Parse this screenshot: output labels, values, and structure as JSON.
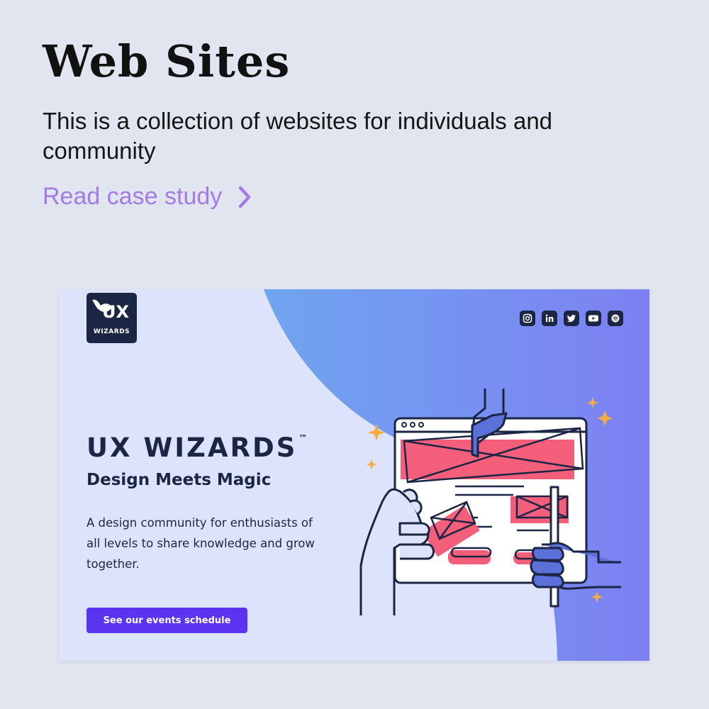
{
  "page": {
    "title": "Web Sites",
    "description": "This is a collection of websites for individuals and community",
    "link_label": "Read case study",
    "link_color": "#a47ae3"
  },
  "card": {
    "logo": {
      "main": "UX",
      "sub": "WIZARDS"
    },
    "social_icons": [
      "instagram-icon",
      "linkedin-icon",
      "twitter-icon",
      "youtube-icon",
      "spotify-icon"
    ],
    "brand_title": "UX WIZARDS",
    "trademark": "™",
    "tagline": "Design Meets Magic",
    "description": "A design community for enthusiasts of all levels to share knowledge and grow together.",
    "cta_label": "See our events schedule",
    "colors": {
      "background": "#dde3fa",
      "gradient_start": "#6fa5f0",
      "gradient_end": "#7d80f2",
      "navy": "#1b2544",
      "cta": "#5b34f0",
      "accent_pink": "#f35f7b",
      "sparkle": "#f5ad3e"
    }
  }
}
